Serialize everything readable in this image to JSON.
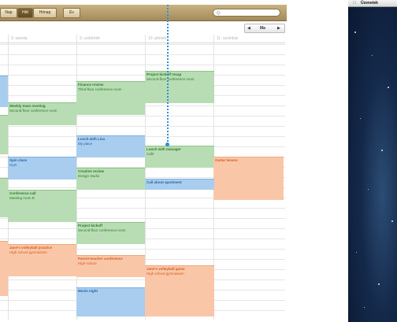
{
  "toolbar": {
    "view_tabs": [
      "Nap",
      "Hét",
      "Hónap",
      "Év"
    ],
    "search_placeholder": "Q-"
  },
  "nav": {
    "prev": "◀",
    "today": "Ma",
    "next": "▶"
  },
  "days": [
    "9. szerda",
    "9. csütörtök",
    "10. péntek",
    "11. szombat"
  ],
  "events": [
    {
      "title": "Project kickoff recap",
      "location": "Second-floor conference room",
      "color": "green"
    },
    {
      "title": "Finance review",
      "location": "Third-floor conference room",
      "color": "green"
    },
    {
      "title": "Weekly team meeting",
      "location": "Second-floor conference room",
      "color": "green"
    },
    {
      "title": "Lunch with Lisa",
      "location": "My place",
      "color": "blue"
    },
    {
      "title": "Lunch with manager",
      "location": "Café",
      "color": "green"
    },
    {
      "title": "Guitar lesson",
      "location": "",
      "color": "orange"
    },
    {
      "title": "Spin class",
      "location": "Gym",
      "color": "blue"
    },
    {
      "title": "Creative review",
      "location": "Design studio",
      "color": "green"
    },
    {
      "title": "Call about apartment",
      "location": "",
      "color": "blue"
    },
    {
      "title": "Conference call",
      "location": "Meeting room B",
      "color": "green"
    },
    {
      "title": "Project kickoff",
      "location": "Second-floor conference room",
      "color": "green"
    },
    {
      "title": "Jane's volleyball practice",
      "location": "High school gymnasium",
      "color": "orange"
    },
    {
      "title": "Parent-teacher conference",
      "location": "High school",
      "color": "orange"
    },
    {
      "title": "Jane's volleyball game",
      "location": "High school gymnasium",
      "color": "orange"
    },
    {
      "title": "Movie night",
      "location": "",
      "color": "blue"
    }
  ],
  "desktop": {
    "menu_title": "Üzenetek"
  },
  "colors": {
    "accent": "#2f8fd8",
    "green": "#b8ddb4",
    "blue": "#a9cdee",
    "orange": "#f9c7a8"
  }
}
